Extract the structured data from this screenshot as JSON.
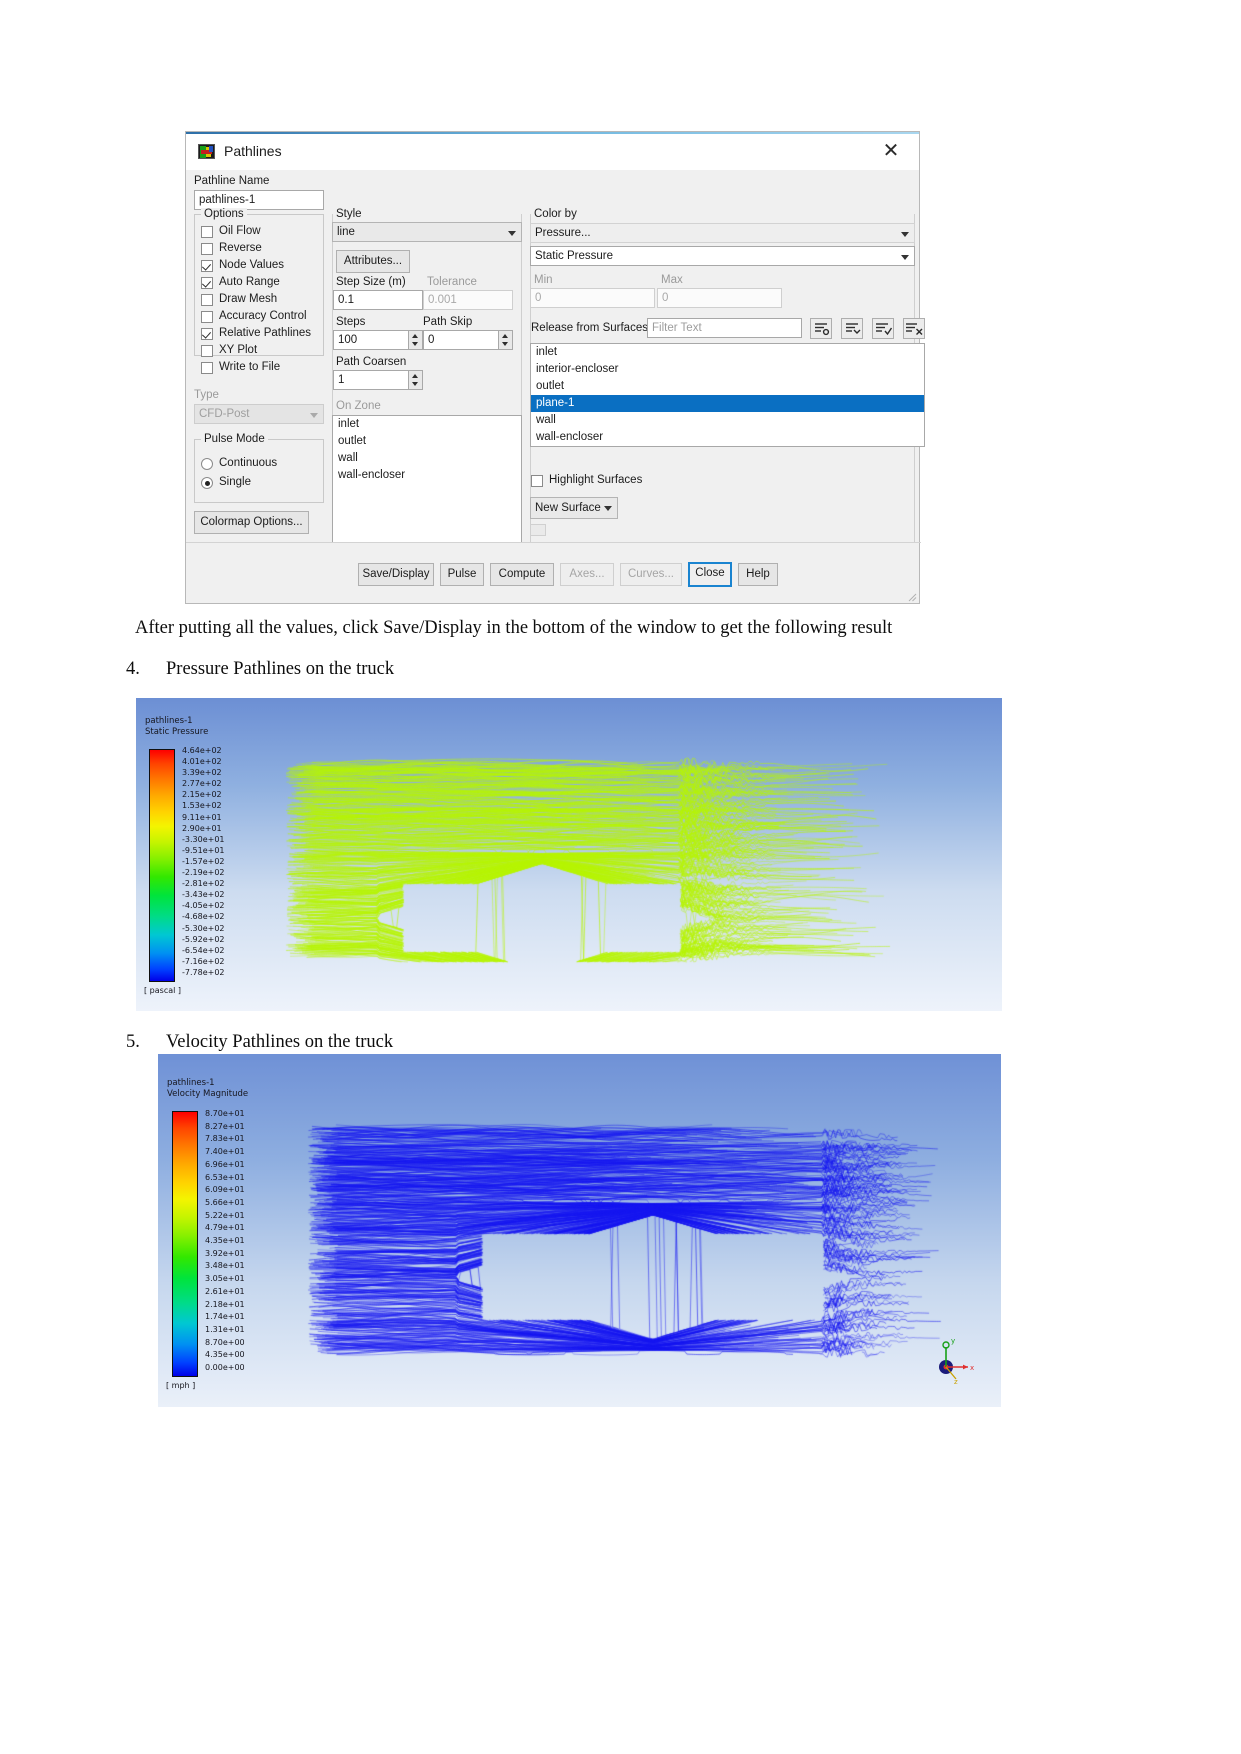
{
  "dialog": {
    "title": "Pathlines",
    "icon": "pathlines-icon",
    "close_icon": "close-icon",
    "pathline_name_label": "Pathline Name",
    "pathline_name_value": "pathlines-1",
    "options": {
      "title": "Options",
      "items": [
        {
          "label": "Oil Flow",
          "checked": false
        },
        {
          "label": "Reverse",
          "checked": false
        },
        {
          "label": "Node Values",
          "checked": true
        },
        {
          "label": "Auto Range",
          "checked": true
        },
        {
          "label": "Draw Mesh",
          "checked": false
        },
        {
          "label": "Accuracy Control",
          "checked": false
        },
        {
          "label": "Relative Pathlines",
          "checked": true
        },
        {
          "label": "XY Plot",
          "checked": false
        },
        {
          "label": "Write to File",
          "checked": false
        }
      ]
    },
    "type": {
      "label": "Type",
      "value": "CFD-Post"
    },
    "pulse_mode": {
      "title": "Pulse Mode",
      "options": [
        {
          "label": "Continuous",
          "selected": false
        },
        {
          "label": "Single",
          "selected": true
        }
      ]
    },
    "colormap_options_label": "Colormap Options...",
    "style": {
      "label": "Style",
      "value": "line",
      "attributes_label": "Attributes..."
    },
    "step_size": {
      "label": "Step Size   (m)",
      "value": "0.1"
    },
    "tolerance": {
      "label": "Tolerance",
      "value": "0.001"
    },
    "steps": {
      "label": "Steps",
      "value": "100"
    },
    "path_skip": {
      "label": "Path Skip",
      "value": "0"
    },
    "path_coarsen": {
      "label": "Path Coarsen",
      "value": "1"
    },
    "on_zone": {
      "label": "On Zone",
      "items": [
        "inlet",
        "outlet",
        "wall",
        "wall-encloser"
      ]
    },
    "color_by": {
      "label": "Color by",
      "category": "Pressure...",
      "field": "Static Pressure"
    },
    "min": {
      "label": "Min",
      "value": "0"
    },
    "max": {
      "label": "Max",
      "value": "0"
    },
    "release_from_surfaces": {
      "label": "Release from Surfaces",
      "filter_placeholder": "Filter Text",
      "toolbar_icons": [
        "list-filter-icon",
        "list-collapse-icon",
        "list-check-icon",
        "list-clear-icon"
      ],
      "items": [
        {
          "label": "inlet",
          "selected": false
        },
        {
          "label": "interior-encloser",
          "selected": false
        },
        {
          "label": "outlet",
          "selected": false
        },
        {
          "label": "plane-1",
          "selected": true
        },
        {
          "label": "wall",
          "selected": false
        },
        {
          "label": "wall-encloser",
          "selected": false
        }
      ]
    },
    "highlight_surfaces": {
      "label": "Highlight Surfaces",
      "checked": false
    },
    "new_surface_label": "New Surface",
    "buttons": [
      {
        "label": "Save/Display",
        "state": "enabled"
      },
      {
        "label": "Pulse",
        "state": "enabled"
      },
      {
        "label": "Compute",
        "state": "enabled"
      },
      {
        "label": "Axes...",
        "state": "disabled"
      },
      {
        "label": "Curves...",
        "state": "disabled"
      },
      {
        "label": "Close",
        "state": "focused"
      },
      {
        "label": "Help",
        "state": "enabled"
      }
    ]
  },
  "document": {
    "paragraph": "After putting all the values, click Save/Display in the bottom of the window to get the following result",
    "item4_number": "4.",
    "item4_text": "Pressure Pathlines on the truck",
    "item5_number": "5.",
    "item5_text": "Velocity Pathlines on the truck"
  },
  "chart_data": [
    {
      "type": "heatmap",
      "title": "pathlines-1",
      "subtitle": "Static Pressure",
      "unit": "[ pascal ]",
      "colormap": "rainbow",
      "legend_position": "left",
      "tick_labels": [
        "4.64e+02",
        "4.01e+02",
        "3.39e+02",
        "2.77e+02",
        "2.15e+02",
        "1.53e+02",
        "9.11e+01",
        "2.90e+01",
        "-3.30e+01",
        "-9.51e+01",
        "-1.57e+02",
        "-2.19e+02",
        "-2.81e+02",
        "-3.43e+02",
        "-4.05e+02",
        "-4.68e+02",
        "-5.30e+02",
        "-5.92e+02",
        "-6.54e+02",
        "-7.16e+02",
        "-7.78e+02"
      ],
      "values": [
        464,
        401,
        339,
        277,
        215,
        153,
        91.1,
        29.0,
        -33.0,
        -95.1,
        -157,
        -219,
        -281,
        -343,
        -405,
        -468,
        -530,
        -592,
        -654,
        -716,
        -778
      ],
      "range": [
        -778,
        464
      ]
    },
    {
      "type": "heatmap",
      "title": "pathlines-1",
      "subtitle": "Velocity Magnitude",
      "unit": "[ mph ]",
      "colormap": "rainbow",
      "legend_position": "left",
      "tick_labels": [
        "8.70e+01",
        "8.27e+01",
        "7.83e+01",
        "7.40e+01",
        "6.96e+01",
        "6.53e+01",
        "6.09e+01",
        "5.66e+01",
        "5.22e+01",
        "4.79e+01",
        "4.35e+01",
        "3.92e+01",
        "3.48e+01",
        "3.05e+01",
        "2.61e+01",
        "2.18e+01",
        "1.74e+01",
        "1.31e+01",
        "8.70e+00",
        "4.35e+00",
        "0.00e+00"
      ],
      "values": [
        87.0,
        82.7,
        78.3,
        74.0,
        69.6,
        65.3,
        60.9,
        56.6,
        52.2,
        47.9,
        43.5,
        39.2,
        34.8,
        30.5,
        26.1,
        21.8,
        17.4,
        13.1,
        8.7,
        4.35,
        0.0
      ],
      "range": [
        0,
        87.0
      ],
      "axes_triad": {
        "x": "x",
        "y": "y",
        "z": "z"
      }
    }
  ]
}
